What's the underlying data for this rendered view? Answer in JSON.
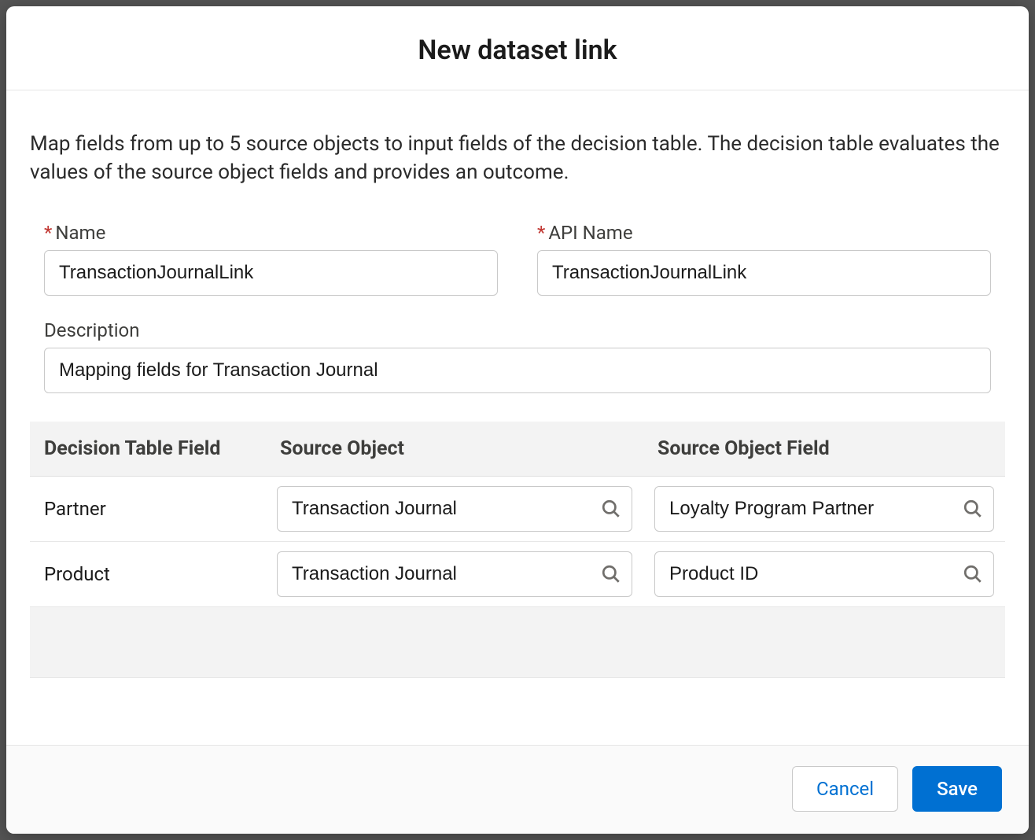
{
  "modal": {
    "title": "New dataset link",
    "intro": "Map fields from up to 5 source objects to input fields of the decision table. The decision table evaluates the values of the source object fields and provides an outcome."
  },
  "form": {
    "name": {
      "label": "Name",
      "value": "TransactionJournalLink",
      "required": true
    },
    "apiName": {
      "label": "API Name",
      "value": "TransactionJournalLink",
      "required": true
    },
    "description": {
      "label": "Description",
      "value": "Mapping fields for Transaction Journal",
      "required": false
    }
  },
  "table": {
    "headers": {
      "decisionTableField": "Decision Table Field",
      "sourceObject": "Source Object",
      "sourceObjectField": "Source Object Field"
    },
    "rows": [
      {
        "decisionTableField": "Partner",
        "sourceObject": "Transaction Journal",
        "sourceObjectField": "Loyalty Program Partner"
      },
      {
        "decisionTableField": "Product",
        "sourceObject": "Transaction Journal",
        "sourceObjectField": "Product ID"
      }
    ]
  },
  "footer": {
    "cancel": "Cancel",
    "save": "Save"
  }
}
